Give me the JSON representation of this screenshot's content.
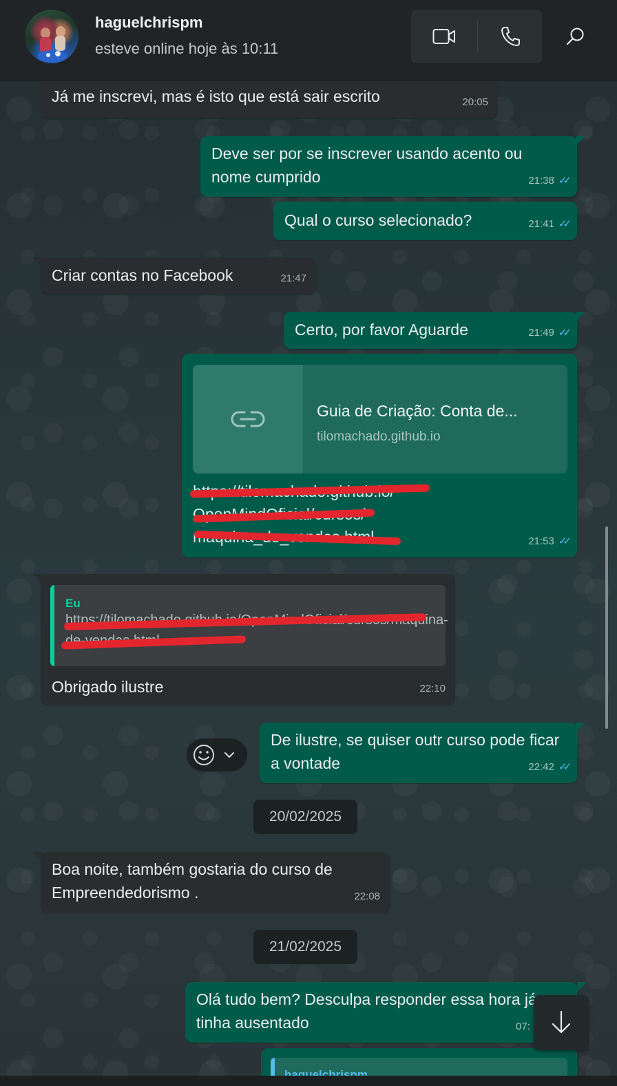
{
  "header": {
    "contact_name": "haguelchrispm",
    "status": "esteve online hoje às 10:11"
  },
  "colors": {
    "incoming_bubble": "#292d2f",
    "outgoing_bubble": "#005b4b",
    "read_ticks": "#53bdeb",
    "quote_accent": "#06cf9c",
    "redaction": "#e3262d"
  },
  "icons": {
    "video": "video-camera-icon",
    "voice": "phone-icon",
    "search": "search-icon",
    "link": "link-icon",
    "emoji": "smiley-icon",
    "dropdown": "chevron-down-icon",
    "scroll": "arrow-down-icon",
    "read": "double-check-icon"
  },
  "messages": [
    {
      "dir": "in",
      "text": "Já me inscrevi, mas é isto que está sair escrito",
      "time": "20:05"
    },
    {
      "dir": "out",
      "text": "Deve ser por se inscrever usando acento ou nome cumprido",
      "time": "21:38",
      "status": "read"
    },
    {
      "dir": "out",
      "text": "Qual o curso selecionado?",
      "time": "21:41",
      "status": "read"
    },
    {
      "dir": "in",
      "text": "Criar contas no Facebook",
      "time": "21:47"
    },
    {
      "dir": "out",
      "text": "Certo, por favor Aguarde",
      "time": "21:49",
      "status": "read"
    },
    {
      "dir": "out",
      "link_preview": {
        "title": "Guia de Criação: Conta de...",
        "domain": "tilomachado.github.io"
      },
      "text_lines": [
        "https://tilomachado.github.io/",
        "OpenMindOficial/cursos/",
        "maquina_de_vendas.html"
      ],
      "time": "21:53",
      "status": "read"
    },
    {
      "dir": "in",
      "quote": {
        "author": "Eu",
        "text": "https://tilomachado.github.io/OpenMindOficial/cursos/maquina-de-vendas.html"
      },
      "text": "Obrigado ilustre",
      "time": "22:10"
    },
    {
      "dir": "out",
      "text": "De ilustre, se quiser outr curso pode ficar a vontade",
      "time": "22:42",
      "status": "read"
    },
    {
      "dir": "date",
      "text": "20/02/2025"
    },
    {
      "dir": "in",
      "text": "Boa noite, também gostaria do curso de Empreendedorismo .",
      "time": "22:08"
    },
    {
      "dir": "date",
      "text": "21/02/2025"
    },
    {
      "dir": "out",
      "text": "Olá tudo bem? Desculpa responder essa hora já tinha ausentado",
      "time": "07:"
    },
    {
      "dir": "out",
      "quote": {
        "author": "haguelchrispm"
      }
    }
  ]
}
